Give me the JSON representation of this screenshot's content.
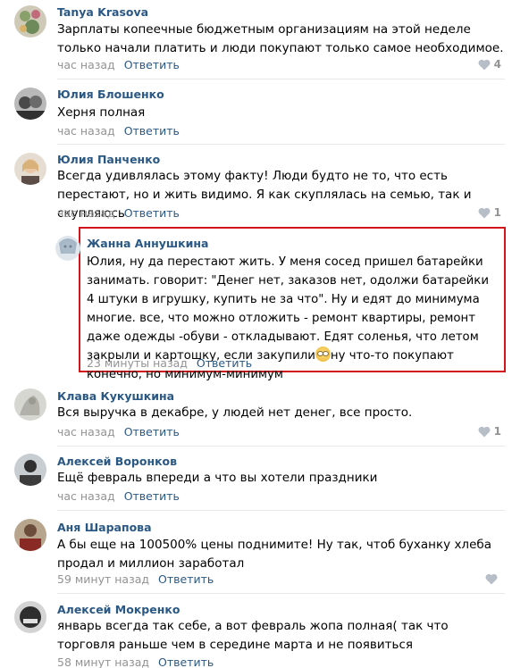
{
  "colors": {
    "author": "#2a5885",
    "meta": "#939393",
    "divider": "#e7e8ec",
    "highlight": "#d3141b"
  },
  "comments": [
    {
      "author": "Tanya Krasova",
      "text": "Зарплаты копеечные бюджетным организациям на этой неделе только начали платить и люди покупают только самое необходимое.",
      "time": "час назад",
      "reply": "Ответить",
      "likes": "4"
    },
    {
      "author": "Юлия Блошенко",
      "text": "Херня полная",
      "time": "час назад",
      "reply": "Ответить",
      "likes": ""
    },
    {
      "author": "Юлия Панченко",
      "text": "Всегда удивлялась этому факту! Люди будто не то, что есть перестают, но и жить видимо. Я как скуплялась на семью, так и скупляюсь",
      "time": "час назад",
      "reply": "Ответить",
      "likes": "1"
    },
    {
      "author": "Клава Кукушкина",
      "text": "Вся выручка в декабре, у людей нет денег, все просто.",
      "time": "час назад",
      "reply": "Ответить",
      "likes": "1"
    },
    {
      "author": "Алексей Воронков",
      "text": "Ещё февраль впереди а что вы хотели праздники",
      "time": "час назад",
      "reply": "Ответить",
      "likes": ""
    },
    {
      "author": "Аня Шарапова",
      "text": "А бы еще на 100500% цены поднимите! Ну так, чтоб буханку хлеба продал и миллион заработал",
      "time": "59 минут назад",
      "reply": "Ответить",
      "likes": ""
    },
    {
      "author": "Алексей Мокренко",
      "text": "январь всегда так себе, а вот февраль жопа полная( так что торговля раньше чем в середине марта и не появиться",
      "time": "58 минут назад",
      "reply": "Ответить",
      "likes": ""
    }
  ],
  "reply": {
    "author": "Жанна Аннушкина",
    "text_before": "Юлия, ну да перестают жить. У меня сосед пришел батарейки занимать. говорит: \"Денег нет, заказов нет, одолжи батарейки 4 штуки в игрушку, купить не за что\". Ну и едят до минимума многие. все, что можно отложить - ремонт квартиры, ремонт даже одежды -обуви - откладывают. Едят соленья, что летом закрыли и картошку, если закупили",
    "emoji_icon": "face-emoji-icon",
    "text_after": "ну что-то покупают конечно, но минимум-минимум",
    "time": "23 минуты назад",
    "reply": "Ответить"
  }
}
